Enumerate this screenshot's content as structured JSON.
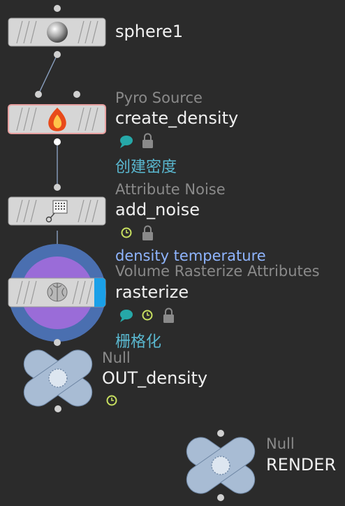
{
  "network": {
    "nodes": [
      {
        "id": "sphere1",
        "type_label": "",
        "name": "sphere1",
        "comment": "",
        "icon": "sphere-icon",
        "flags": []
      },
      {
        "id": "create_density",
        "type_label": "Pyro Source",
        "name": "create_density",
        "comment": "创建密度",
        "icon": "fire-icon",
        "flags": [
          "comment-bubble-icon",
          "lock-icon"
        ]
      },
      {
        "id": "add_noise",
        "type_label": "Attribute Noise",
        "name": "add_noise",
        "comment": "",
        "icon": "noise-grid-icon",
        "flags": [
          "timedep-clock-icon",
          "lock-icon"
        ]
      },
      {
        "id": "rasterize",
        "type_label": "Volume Rasterize Attributes",
        "name": "rasterize",
        "comment": "栅格化",
        "attributes": "density temperature",
        "icon": "brain-icon",
        "flags": [
          "comment-bubble-icon",
          "timedep-clock-icon",
          "lock-icon"
        ]
      },
      {
        "id": "OUT_density",
        "type_label": "Null",
        "name": "OUT_density",
        "comment": "",
        "icon": "null-x-icon",
        "flags": [
          "timedep-clock-icon"
        ]
      },
      {
        "id": "RENDER",
        "type_label": "Null",
        "name": "RENDER",
        "comment": "",
        "icon": "null-x-icon",
        "flags": []
      }
    ]
  },
  "colors": {
    "background": "#2b2b2b",
    "wire": "#8aa0c0",
    "node_body": "#d6d6d6",
    "selected_outline": "#e8a0a0",
    "display_flag": "#1aa0e8",
    "ring_outer": "#4a6fb0",
    "ring_inner": "#9a6cd8",
    "null_shape": "#a8bcd4",
    "comment_text": "#5ab8d0",
    "attr_text": "#8fb5ff",
    "clock_icon": "#c8e060",
    "comment_icon": "#26a8a8"
  }
}
